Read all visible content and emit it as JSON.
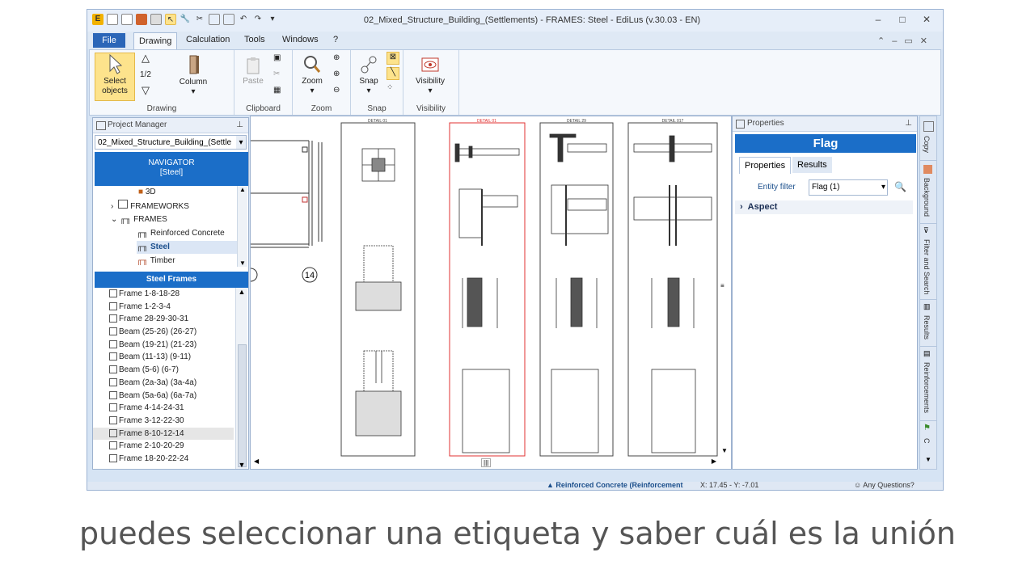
{
  "window": {
    "title": "02_Mixed_Structure_Building_(Settlements) -  FRAMES: Steel - EdiLus (v.30.03 - EN)",
    "controls": [
      "–",
      "□",
      "✕"
    ]
  },
  "menu": {
    "file": "File",
    "tabs": [
      "Drawing",
      "Calculation",
      "Tools",
      "Windows",
      "?"
    ],
    "active_tab": "Drawing"
  },
  "ribbon": {
    "drawing": {
      "select_label_1": "Select",
      "select_label_2": "objects",
      "fraction": "1/2",
      "column": "Column",
      "group": "Drawing"
    },
    "clipboard": {
      "paste": "Paste",
      "group": "Clipboard"
    },
    "zoom": {
      "zoom": "Zoom",
      "group": "Zoom"
    },
    "snap": {
      "snap": "Snap",
      "group": "Snap"
    },
    "visibility": {
      "visibility": "Visibility",
      "group": "Visibility"
    }
  },
  "project_manager": {
    "title": "Project Manager",
    "combo_value": "02_Mixed_Structure_Building_(Settle",
    "navigator_line1": "NAVIGATOR",
    "navigator_line2": "[Steel]",
    "tree": [
      "3D",
      "FRAMEWORKS",
      "FRAMES",
      "Reinforced Concrete",
      "Steel",
      "Timber"
    ],
    "steel_frames_header": "Steel Frames",
    "frames": [
      "Frame 1-8-18-28",
      "Frame 1-2-3-4",
      "Frame 28-29-30-31",
      "Beam  (25-26) (26-27)",
      "Beam  (19-21) (21-23)",
      "Beam  (11-13) (9-11)",
      "Beam  (5-6) (6-7)",
      "Beam  (2a-3a) (3a-4a)",
      "Beam  (5a-6a) (6a-7a)",
      "Frame 4-14-24-31",
      "Frame 3-12-22-30",
      "Frame 8-10-12-14",
      "Frame 2-10-20-29",
      "Frame 18-20-22-24"
    ],
    "selected_frame_index": 11
  },
  "canvas": {
    "node_label": "14",
    "sheets": [
      "DETAIL 01",
      "DETAIL 01",
      "DETAIL 29",
      "DETAIL 017"
    ]
  },
  "properties": {
    "title": "Properties",
    "header": "Flag",
    "tabs": [
      "Properties",
      "Results"
    ],
    "entity_filter_label": "Entity filter",
    "entity_filter_value": "Flag (1)",
    "section": "Aspect"
  },
  "sidebar": [
    "Copy",
    "Background",
    "Filter and Search",
    "Results",
    "Reinforcements",
    "C"
  ],
  "status": {
    "mode": "Reinforced Concrete (Reinforcement",
    "coords": "X: 17.45 - Y: -7.01",
    "help": "Any Questions?"
  },
  "caption": "puedes seleccionar una etiqueta y saber cuál es la unión",
  "colors": {
    "accent": "#1b6ec8",
    "selected": "#fde38c",
    "red_sheet": "#e03030"
  }
}
